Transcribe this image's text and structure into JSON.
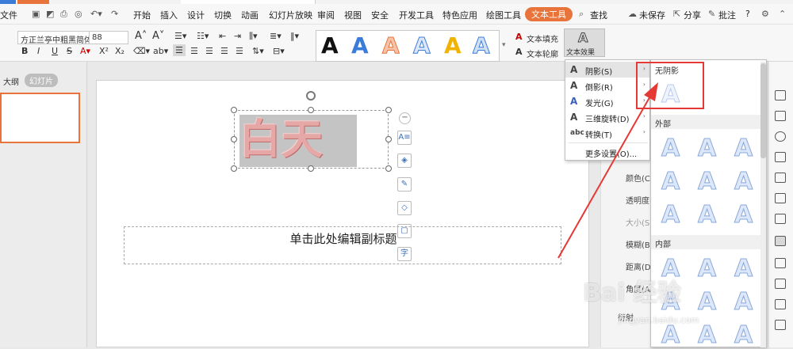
{
  "menubar": {
    "file": "文件",
    "items": [
      "开始",
      "插入",
      "设计",
      "切换",
      "动画",
      "幻灯片放映",
      "审阅",
      "视图",
      "安全",
      "开发工具",
      "特色应用",
      "绘图工具",
      "文本工具"
    ],
    "active": "文本工具",
    "search": "查找",
    "unsaved": "未保存",
    "share": "分享",
    "comment": "批注",
    "help": "?"
  },
  "ribbon": {
    "font_name": "方正兰亭中粗黑简体",
    "font_size": "88",
    "text_fill": "文本填充",
    "text_outline": "文本轮廓",
    "text_effect": "文本效果",
    "style_letter": "A"
  },
  "leftpanel": {
    "tab_outline": "大纲",
    "tab_slides": "幻灯片"
  },
  "slide": {
    "title_text": "白天",
    "subtitle_placeholder": "单击此处编辑副标题"
  },
  "effect_menu": {
    "items": [
      {
        "icon": "A",
        "label": "阴影(S)",
        "arrow": "›"
      },
      {
        "icon": "A",
        "label": "倒影(R)",
        "arrow": "›"
      },
      {
        "icon": "A",
        "label": "发光(G)",
        "arrow": "›"
      },
      {
        "icon": "A",
        "label": "三维旋转(D)",
        "arrow": "›"
      },
      {
        "icon": "abc",
        "label": "转换(T)",
        "arrow": "›"
      },
      {
        "icon": "",
        "label": "更多设置(O)...",
        "arrow": ""
      }
    ]
  },
  "shadow_submenu": {
    "no_shadow": "无阴影",
    "outer": "外部",
    "inner": "内部",
    "letter": "A"
  },
  "rightpanel": {
    "labels": [
      "颜色(C)",
      "透明度(T)",
      "大小(S)",
      "模糊(B)",
      "距离(D)",
      "角度(A)",
      "衍射"
    ]
  },
  "watermark": {
    "main": "Bai 经验",
    "sub": "jingyan.baidu.com"
  },
  "colors": {
    "accent": "#e8743b",
    "highlight_red": "#e53935",
    "text_a_black": "#111111",
    "text_a_blue": "#3b7cd8",
    "text_a_orange": "#e8743b",
    "text_a_gold": "#f0b400"
  }
}
